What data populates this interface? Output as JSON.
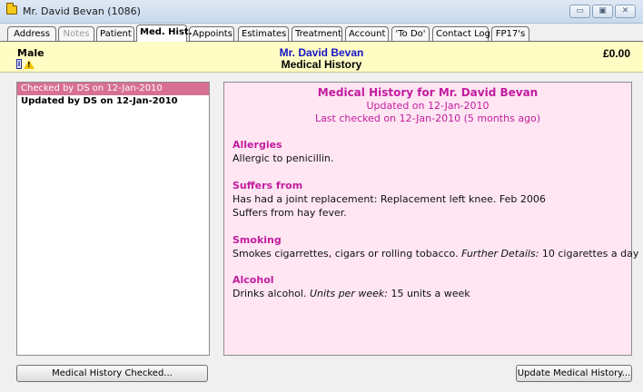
{
  "window": {
    "title": "Mr. David Bevan  (1086)",
    "controls": {
      "minimize": "▭",
      "maximize": "▣",
      "close": "✕"
    }
  },
  "tabs": [
    {
      "label": "Address",
      "state": "normal"
    },
    {
      "label": "Notes",
      "state": "disabled"
    },
    {
      "label": "Patient",
      "state": "normal"
    },
    {
      "label": "Med. Hist.",
      "state": "active"
    },
    {
      "label": "Appoints",
      "state": "normal"
    },
    {
      "label": "Estimates",
      "state": "normal"
    },
    {
      "label": "Treatment",
      "state": "normal"
    },
    {
      "label": "Account",
      "state": "normal"
    },
    {
      "label": "'To Do'",
      "state": "normal"
    },
    {
      "label": "Contact Log",
      "state": "normal"
    },
    {
      "label": "FP17's",
      "state": "normal"
    }
  ],
  "header": {
    "gender": "Male",
    "patient_name": "Mr. David Bevan",
    "section": "Medical History",
    "balance": "£0.00",
    "icons": [
      "info-icon",
      "warning-icon"
    ]
  },
  "history_list": [
    {
      "text": "Checked by DS on 12-Jan-2010",
      "selected": true,
      "bold": false
    },
    {
      "text": "Updated by DS on 12-Jan-2010",
      "selected": false,
      "bold": true
    }
  ],
  "detail": {
    "title": "Medical History for Mr. David Bevan",
    "updated": "Updated on 12-Jan-2010",
    "last_checked": "Last checked on 12-Jan-2010 (5 months ago)",
    "allergies": {
      "heading": "Allergies",
      "text": "Allergic to penicillin."
    },
    "suffers": {
      "heading": "Suffers from",
      "line1": "Has had a joint replacement: Replacement left knee. Feb 2006",
      "line2": "Suffers from hay fever."
    },
    "smoking": {
      "heading": "Smoking",
      "text": "Smokes cigarrettes, cigars or rolling tobacco.",
      "label": "Further Details:",
      "value": "10 cigarettes a day"
    },
    "alcohol": {
      "heading": "Alcohol",
      "text": "Drinks alcohol.",
      "label": "Units per week:",
      "value": "15 units a week"
    }
  },
  "buttons": {
    "checked": "Medical History Checked...",
    "update": "Update Medical History..."
  },
  "colors": {
    "accent_magenta": "#c21ca0",
    "selected_row": "#d86f94",
    "info_bar": "#fffcc4",
    "detail_bg": "#ffe6f2",
    "patient_name": "#1616c8"
  }
}
